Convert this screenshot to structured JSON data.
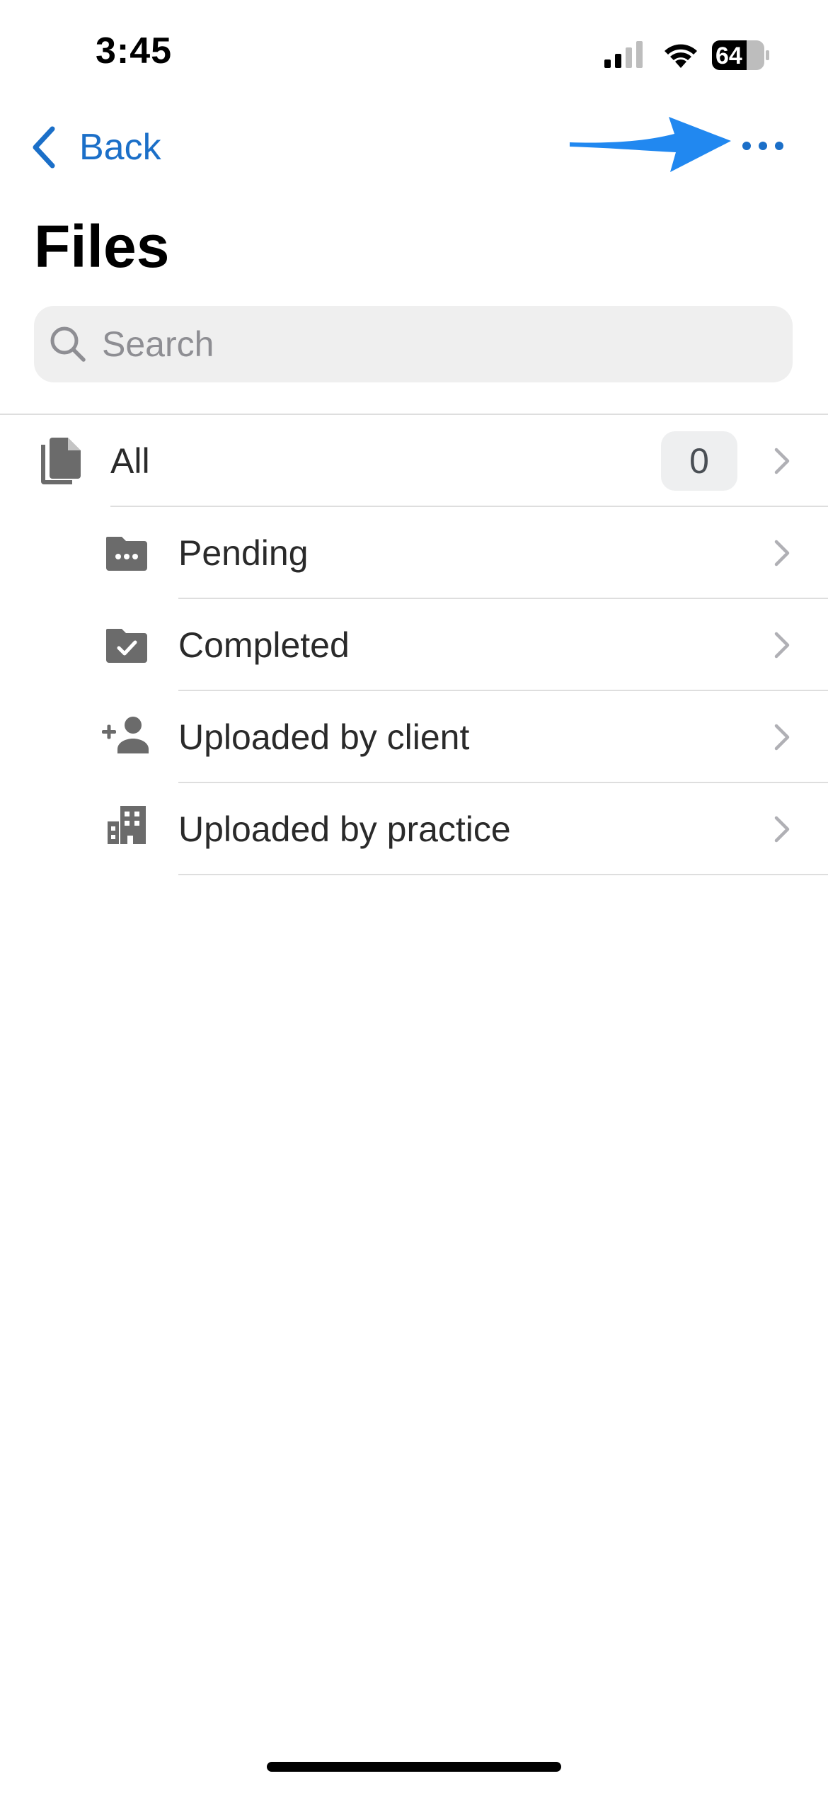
{
  "status_bar": {
    "time": "3:45",
    "battery": "64"
  },
  "nav": {
    "back_label": "Back",
    "more_icon": "ellipsis-icon",
    "accent_color": "#1b6fc8",
    "annotation_color": "#2188f0"
  },
  "page": {
    "title": "Files"
  },
  "search": {
    "placeholder": "Search",
    "value": ""
  },
  "list": {
    "items": [
      {
        "label": "All",
        "icon": "documents-icon",
        "count": "0"
      },
      {
        "label": "Pending",
        "icon": "folder-pending-icon"
      },
      {
        "label": "Completed",
        "icon": "folder-check-icon"
      },
      {
        "label": "Uploaded by client",
        "icon": "person-add-icon"
      },
      {
        "label": "Uploaded by practice",
        "icon": "building-icon"
      }
    ]
  }
}
